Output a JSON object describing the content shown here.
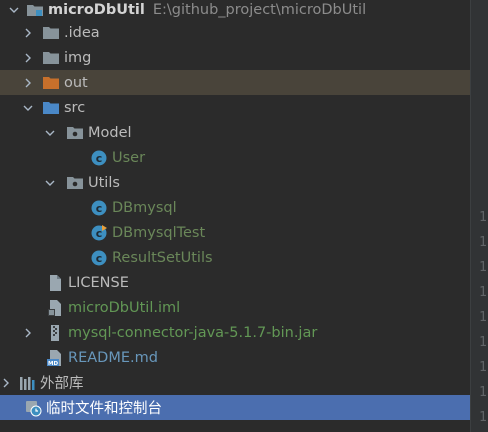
{
  "project": {
    "name": "microDbUtil",
    "path": "E:\\github_project\\microDbUtil"
  },
  "tree": {
    "idea": ".idea",
    "img": "img",
    "out": "out",
    "src": "src",
    "model": "Model",
    "user": "User",
    "utils": "Utils",
    "dbmysql": "DBmysql",
    "dbmysqltest": "DBmysqlTest",
    "resultsetutils": "ResultSetUtils",
    "license": "LICENSE",
    "iml": "microDbUtil.iml",
    "jar": "mysql-connector-java-5.1.7-bin.jar",
    "readme": "README.md",
    "external_libs": "外部库",
    "scratches": "临时文件和控制台"
  },
  "gutter": [
    "1",
    "1",
    "1",
    "1",
    "1",
    "1",
    "1",
    "1",
    "1"
  ],
  "colors": {
    "background": "#2b2b2b",
    "highlight": "#49443a",
    "selection": "#4b6eaf",
    "class_icon": "#3d8fc0",
    "folder": "#87939a",
    "out_folder": "#c7702b"
  }
}
